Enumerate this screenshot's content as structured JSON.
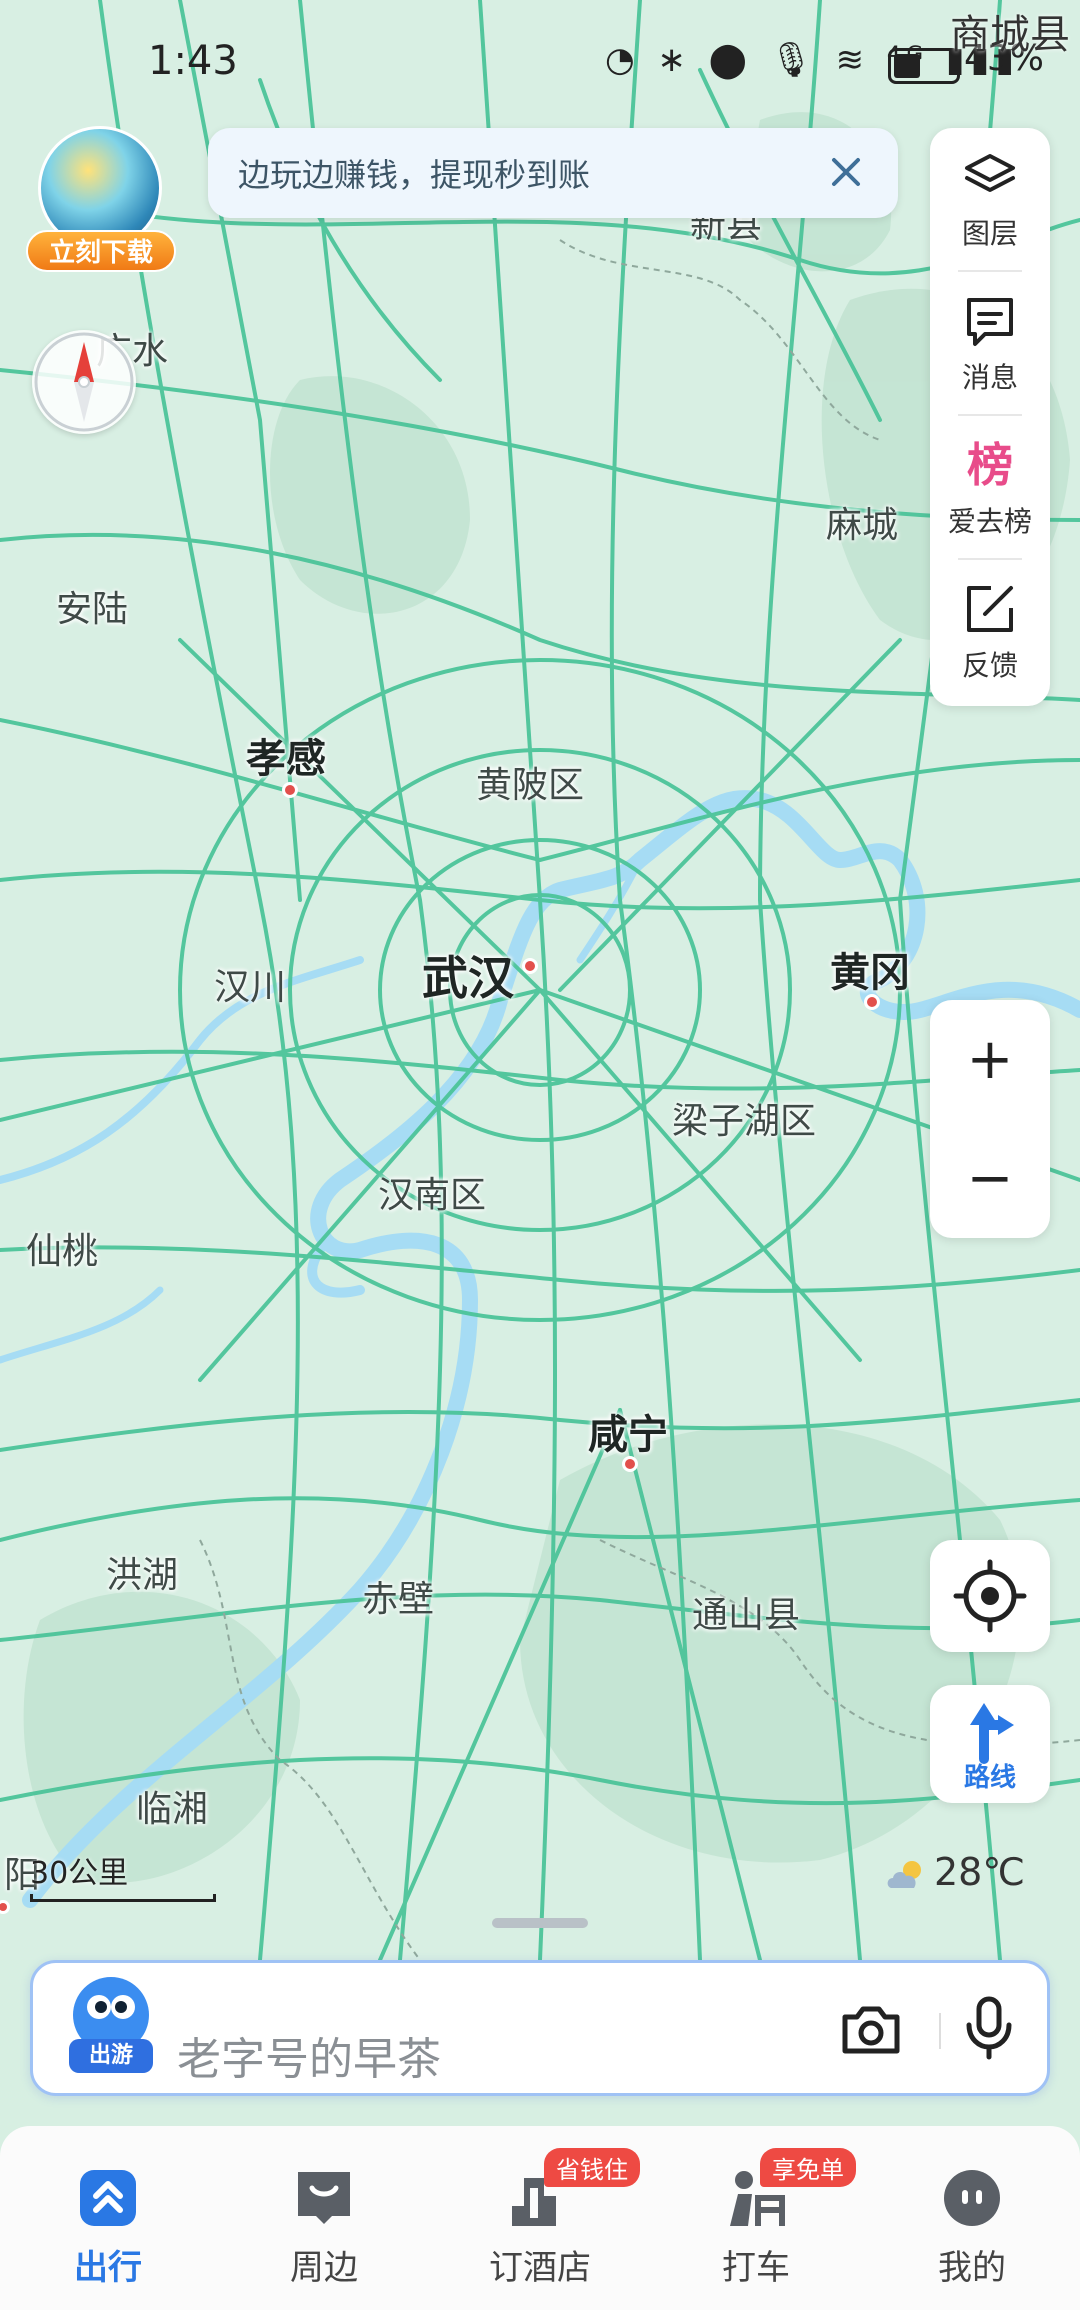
{
  "status_bar": {
    "time": "1:43",
    "icons": "◔ ∗ ⬤ 🎙 ≋ ⁴ᴳ ▮▮▮",
    "battery_text": "43%",
    "battery_level": 0.43,
    "top_right_city": "商城县"
  },
  "game_ad": {
    "button_label": "立刻下载"
  },
  "promo": {
    "text": "边玩边赚钱，提现秒到账"
  },
  "map": {
    "labels": [
      {
        "name": "新县",
        "major": false
      },
      {
        "name": "广水",
        "major": false
      },
      {
        "name": "麻城",
        "major": false
      },
      {
        "name": "安陆",
        "major": false
      },
      {
        "name": "孝感",
        "major": true
      },
      {
        "name": "黄陂区",
        "major": false
      },
      {
        "name": "武汉",
        "major": true
      },
      {
        "name": "汉川",
        "major": false
      },
      {
        "name": "黄冈",
        "major": true
      },
      {
        "name": "梁子湖区",
        "major": false
      },
      {
        "name": "汉南区",
        "major": false
      },
      {
        "name": "仙桃",
        "major": false
      },
      {
        "name": "咸宁",
        "major": true
      },
      {
        "name": "洪湖",
        "major": false
      },
      {
        "name": "赤壁",
        "major": false
      },
      {
        "name": "通山县",
        "major": false
      },
      {
        "name": "临湘",
        "major": false
      },
      {
        "name": "阳",
        "major": false
      }
    ]
  },
  "tools": [
    {
      "label": "图层",
      "icon": "layers-icon"
    },
    {
      "label": "消息",
      "icon": "message-icon"
    },
    {
      "label": "爱去榜",
      "icon": "ranking-icon",
      "icon_text": "榜"
    },
    {
      "label": "反馈",
      "icon": "feedback-icon"
    }
  ],
  "zoom": {
    "in": "+",
    "out": "−"
  },
  "route": {
    "label": "路线"
  },
  "scale": {
    "label": "30公里"
  },
  "weather": {
    "temp": "28℃"
  },
  "search": {
    "mascot_tag": "出游",
    "placeholder": "老字号的早茶"
  },
  "nav": {
    "items": [
      {
        "label": "出行",
        "active": true
      },
      {
        "label": "周边",
        "active": false
      },
      {
        "label": "订酒店",
        "active": false,
        "badge": "省钱住"
      },
      {
        "label": "打车",
        "active": false,
        "badge": "享免单"
      },
      {
        "label": "我的",
        "active": false
      }
    ]
  },
  "colors": {
    "map_bg": "#d7efe2",
    "road": "#4cc49a",
    "water": "#a6dcf4",
    "accent_blue": "#2a78e4",
    "badge_red": "#ee4a43"
  }
}
